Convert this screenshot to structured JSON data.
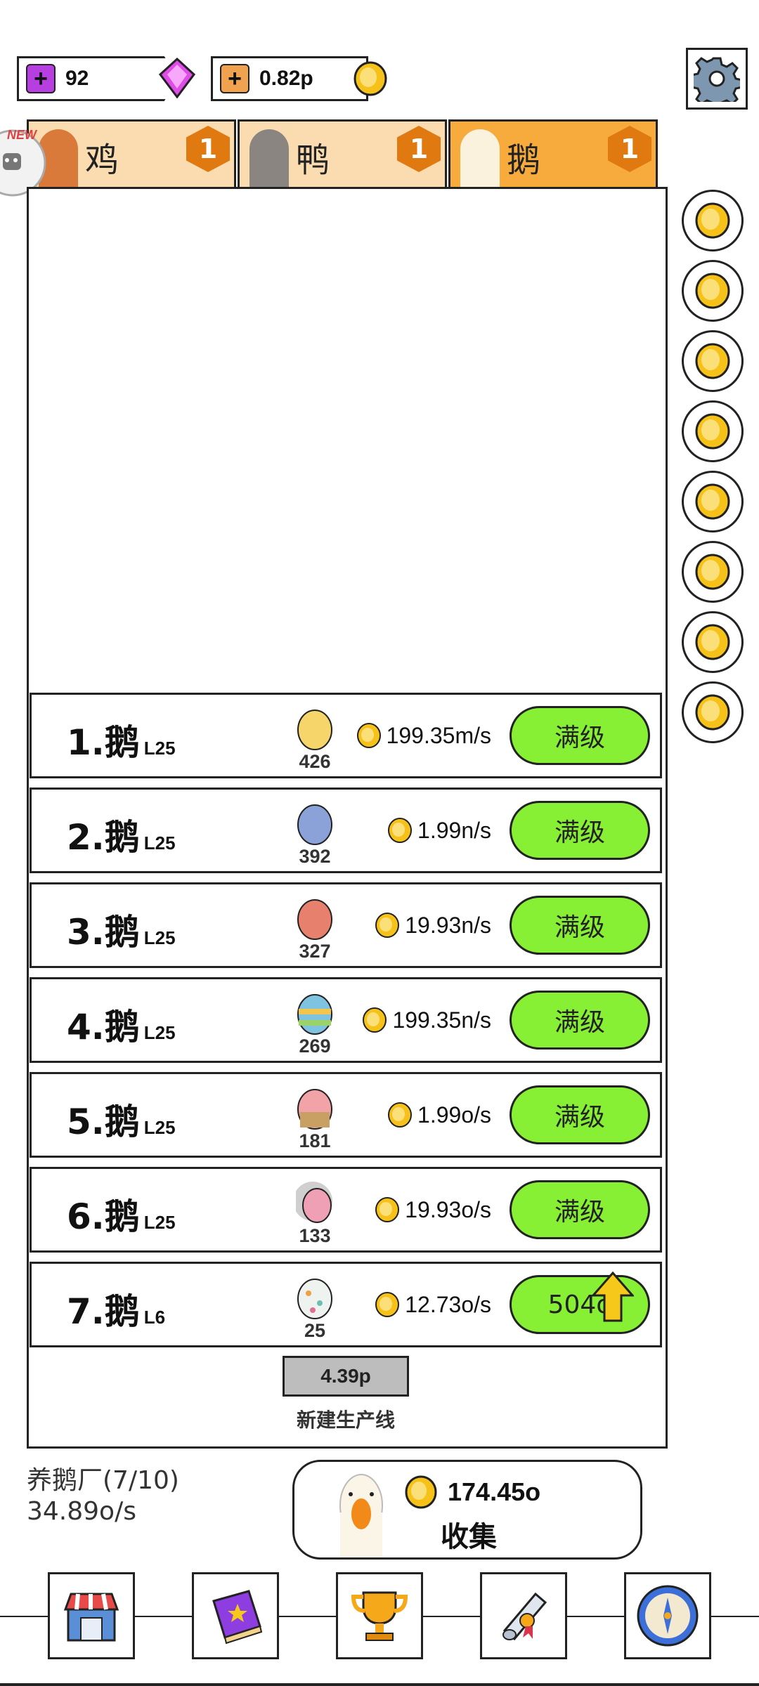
{
  "currency": {
    "gems": "92",
    "coins": "0.82p"
  },
  "tabs": [
    {
      "label": "鸡",
      "badge": "1",
      "active": false
    },
    {
      "label": "鸭",
      "badge": "1",
      "active": false
    },
    {
      "label": "鹅",
      "badge": "1",
      "active": true
    }
  ],
  "news_badge": "NEW",
  "rows": [
    {
      "name": "1.鹅",
      "level": "L25",
      "count": "426",
      "rate": "199.35m/s",
      "action": "满级",
      "egg_color": "#f6d56a"
    },
    {
      "name": "2.鹅",
      "level": "L25",
      "count": "392",
      "rate": "1.99n/s",
      "action": "满级",
      "egg_color": "#8aa2d8"
    },
    {
      "name": "3.鹅",
      "level": "L25",
      "count": "327",
      "rate": "19.93n/s",
      "action": "满级",
      "egg_color": "#e8806e"
    },
    {
      "name": "4.鹅",
      "level": "L25",
      "count": "269",
      "rate": "199.35n/s",
      "action": "满级",
      "egg_color": "#7fc3e0"
    },
    {
      "name": "5.鹅",
      "level": "L25",
      "count": "181",
      "rate": "1.99o/s",
      "action": "满级",
      "egg_color": "#f2a3a8"
    },
    {
      "name": "6.鹅",
      "level": "L25",
      "count": "133",
      "rate": "19.93o/s",
      "action": "满级",
      "egg_color": "#f0a0b4"
    },
    {
      "name": "7.鹅",
      "level": "L6",
      "count": "25",
      "rate": "12.73o/s",
      "action": "504o",
      "egg_color": "#eef3f0"
    }
  ],
  "build": {
    "price": "4.39p",
    "label": "新建生产线"
  },
  "factory": {
    "title": "养鹅厂(7/10)",
    "rate": "34.89o/s"
  },
  "collect": {
    "amount": "174.45o",
    "label": "收集"
  },
  "nav": [
    "shop-icon",
    "book-icon",
    "trophy-icon",
    "scroll-icon",
    "compass-icon"
  ],
  "colors": {
    "accent_green": "#88f034",
    "tab_inactive": "#fbdcb0",
    "tab_active": "#f8ab3d",
    "coin_gold": "#f6c21a"
  }
}
